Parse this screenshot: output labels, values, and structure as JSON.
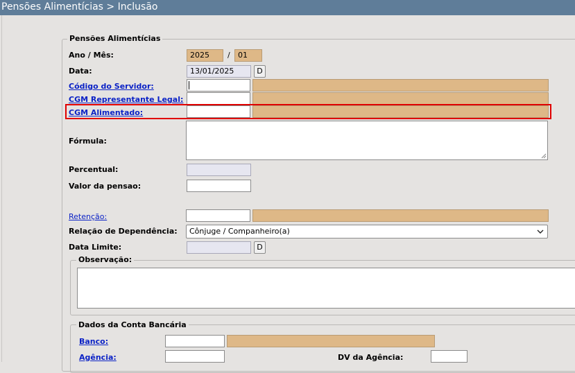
{
  "window": {
    "title": "Pensões Alimentícias > Inclusão"
  },
  "fieldset_main": {
    "legend": "Pensões Alimentícias"
  },
  "form": {
    "ano_mes": {
      "label": "Ano / Mês:",
      "ano": "2025",
      "separator": "/",
      "mes": "01"
    },
    "data": {
      "label": "Data:",
      "value": "13/01/2025",
      "button": "D"
    },
    "codigo_servidor": {
      "label": "Código do Servidor:",
      "value": "",
      "description": ""
    },
    "cgm_representante": {
      "label": "CGM Representante Legal:",
      "value": "",
      "description": ""
    },
    "cgm_alimentado": {
      "label": "CGM Alimentado:",
      "value": "",
      "description": ""
    },
    "formula": {
      "label": "Fórmula:",
      "value": ""
    },
    "percentual": {
      "label": "Percentual:",
      "value": ""
    },
    "valor_pensao": {
      "label": "Valor da pensao:",
      "value": ""
    },
    "retencao": {
      "label": "Retenção:",
      "value": "",
      "description": ""
    },
    "relacao_dependencia": {
      "label": "Relação de Dependência:",
      "selected": "Cônjuge / Companheiro(a)"
    },
    "data_limite": {
      "label": "Data Limite:",
      "value": "",
      "button": "D"
    }
  },
  "observacao": {
    "legend": "Observação:",
    "value": ""
  },
  "conta_bancaria": {
    "legend": "Dados da Conta Bancária",
    "banco": {
      "label": "Banco:",
      "value": "",
      "description": ""
    },
    "agencia": {
      "label": "Agência:",
      "value": ""
    },
    "dv_agencia": {
      "label": "DV da Agência:",
      "value": ""
    }
  },
  "colors": {
    "titlebar": "#5f7d99",
    "readonly_tan": "#deb887",
    "link": "#0b22c6",
    "highlight": "#e00000"
  }
}
